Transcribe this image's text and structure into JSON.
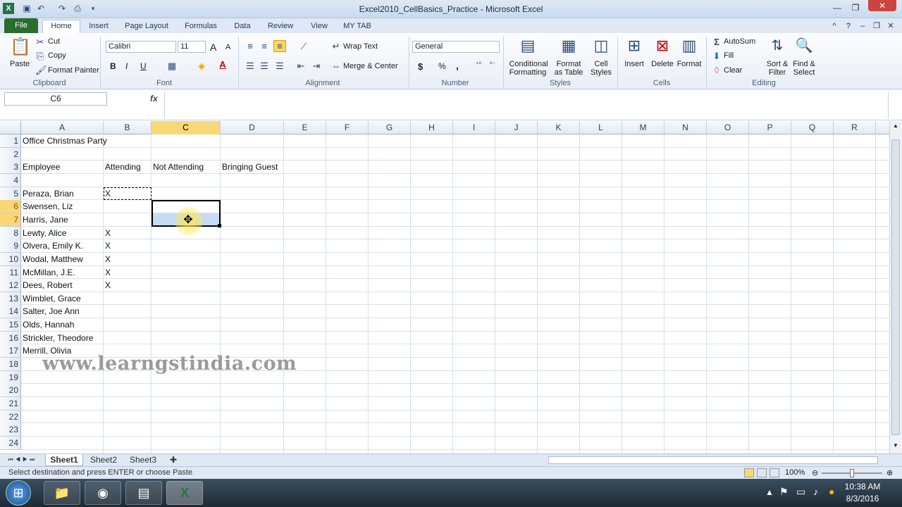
{
  "window": {
    "title": "Excel2010_CellBasics_Practice - Microsoft Excel"
  },
  "ribbon_tabs": [
    "File",
    "Home",
    "Insert",
    "Page Layout",
    "Formulas",
    "Data",
    "Review",
    "View",
    "MY TAB"
  ],
  "clipboard": {
    "paste": "Paste",
    "cut": "Cut",
    "copy": "Copy",
    "format_painter": "Format Painter",
    "label": "Clipboard"
  },
  "font": {
    "name": "Calibri",
    "size": "11",
    "label": "Font",
    "bold": "B",
    "italic": "I",
    "underline": "U",
    "grow": "A",
    "shrink": "A"
  },
  "alignment": {
    "wrap": "Wrap Text",
    "merge": "Merge & Center",
    "label": "Alignment"
  },
  "number": {
    "format": "General",
    "currency": "$",
    "percent": "%",
    "comma": ",",
    "label": "Number"
  },
  "styles": {
    "conditional_1": "Conditional",
    "conditional_2": "Formatting",
    "format_table_1": "Format",
    "format_table_2": "as Table",
    "cell_styles_1": "Cell",
    "cell_styles_2": "Styles",
    "label": "Styles"
  },
  "cells_group": {
    "insert": "Insert",
    "delete": "Delete",
    "format": "Format",
    "label": "Cells"
  },
  "editing": {
    "autosum": "AutoSum",
    "fill": "Fill",
    "clear": "Clear",
    "sort_1": "Sort &",
    "sort_2": "Filter",
    "find_1": "Find &",
    "find_2": "Select",
    "label": "Editing"
  },
  "formula_bar": {
    "name_box": "C6",
    "fx": "fx",
    "value": ""
  },
  "columns": [
    "A",
    "B",
    "C",
    "D",
    "E",
    "F",
    "G",
    "H",
    "I",
    "J",
    "K",
    "L",
    "M",
    "N",
    "O",
    "P",
    "Q",
    "R"
  ],
  "rows": [
    "1",
    "2",
    "3",
    "4",
    "5",
    "6",
    "7",
    "8",
    "9",
    "10",
    "11",
    "12",
    "13",
    "14",
    "15",
    "16",
    "17",
    "18",
    "19",
    "20",
    "21",
    "22",
    "23",
    "24"
  ],
  "cells": {
    "A1": "Office Christmas Party",
    "A3": "Employee",
    "B3": "Attending",
    "C3": "Not Attending",
    "D3": "Bringing Guest",
    "A5": "Peraza, Brian",
    "B5": "X",
    "A6": "Swensen, Liz",
    "A7": "Harris, Jane",
    "A8": "Lewty, Alice",
    "B8": "X",
    "A9": "Olvera, Emily K.",
    "B9": "X",
    "A10": "Wodal, Matthew",
    "B10": "X",
    "A11": "McMillan, J.E.",
    "B11": "X",
    "A12": "Dees, Robert",
    "B12": "X",
    "A13": "Wimblet, Grace",
    "A14": "Salter, Joe Ann",
    "A15": "Olds, Hannah",
    "A16": "Strickler, Theodore",
    "A17": "Merrill, Olivia"
  },
  "watermark": "www.learngstindia.com",
  "sheets": [
    "Sheet1",
    "Sheet2",
    "Sheet3"
  ],
  "status": {
    "message": "Select destination and press ENTER or choose Paste",
    "zoom": "100%"
  },
  "taskbar": {
    "time": "10:38 AM",
    "date": "8/3/2016"
  },
  "colors": {
    "file_tab": "#2a6e2f",
    "selected_header": "#f8d776",
    "selection_fill": "#c5dcf5"
  }
}
